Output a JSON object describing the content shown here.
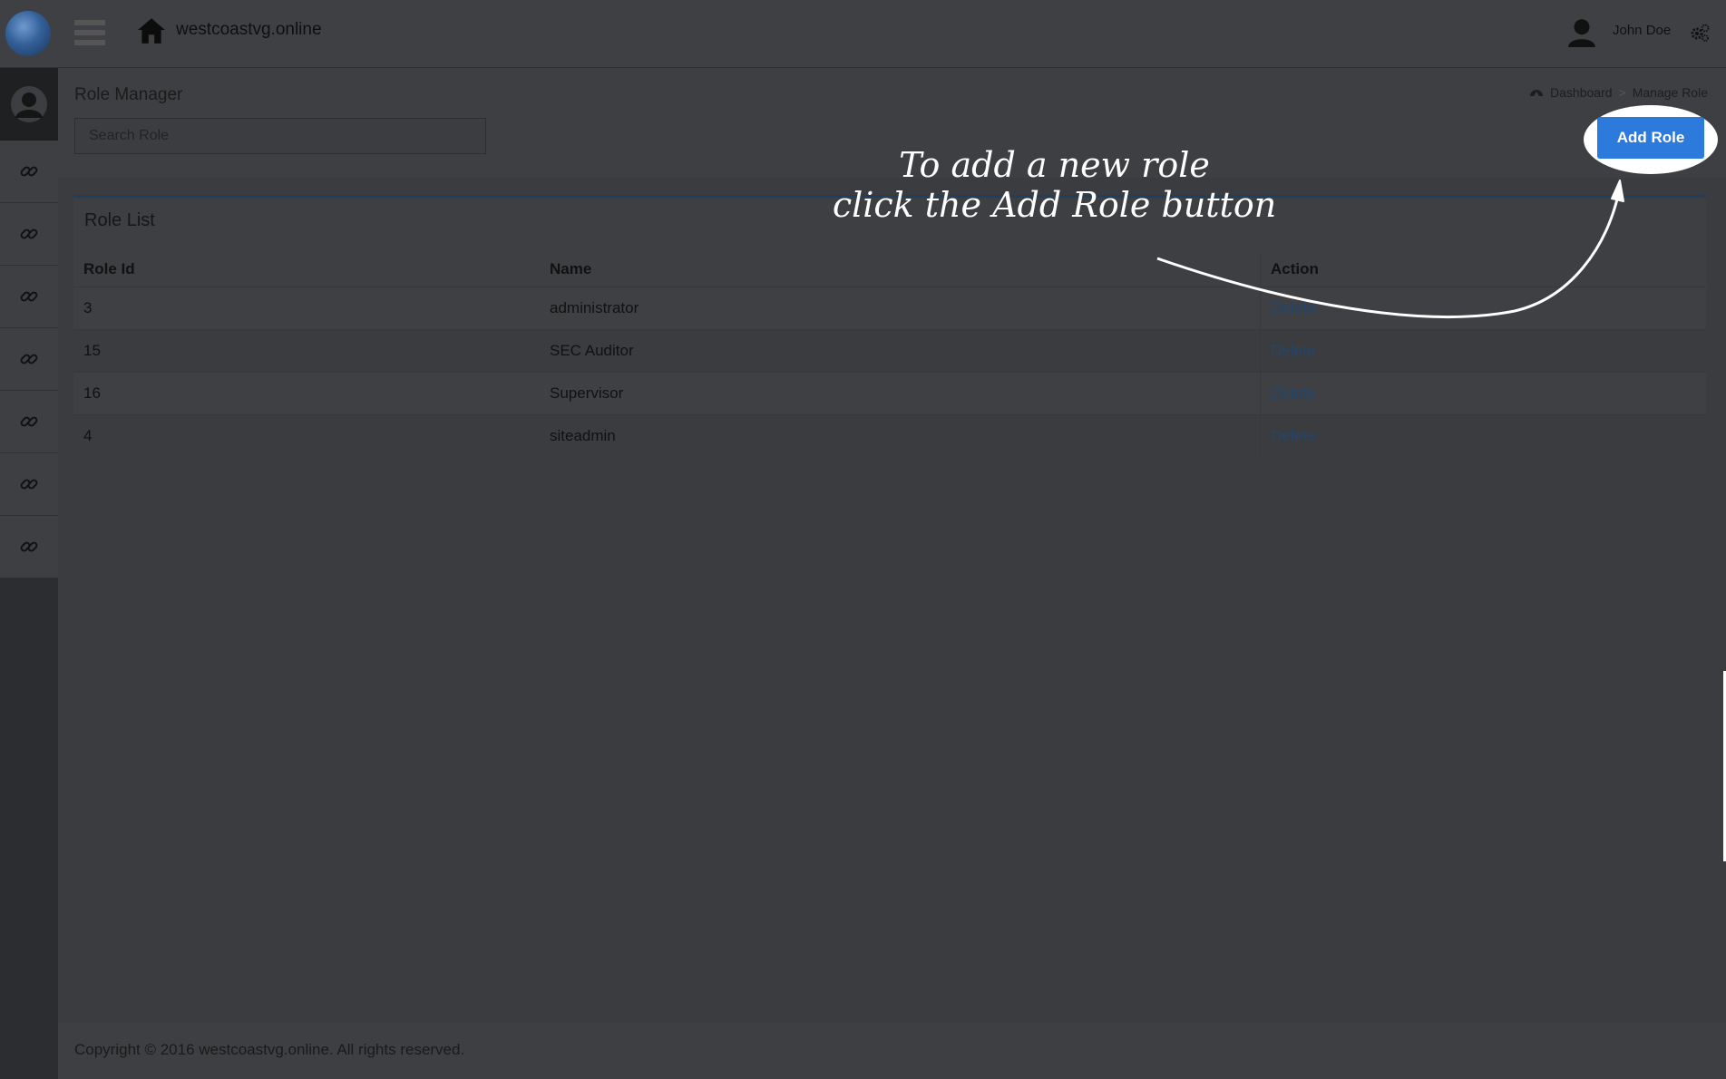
{
  "header": {
    "site_name": "westcoastvg.online",
    "user_name": "John Doe"
  },
  "sidebar": {
    "items": [
      {
        "icon": "link-icon"
      },
      {
        "icon": "link-icon"
      },
      {
        "icon": "link-icon"
      },
      {
        "icon": "link-icon"
      },
      {
        "icon": "link-icon"
      },
      {
        "icon": "link-icon"
      },
      {
        "icon": "link-icon"
      }
    ]
  },
  "page": {
    "title": "Role Manager",
    "search_placeholder": "Search Role",
    "add_role_label": "Add Role",
    "breadcrumb": [
      "Dashboard",
      "Manage Role"
    ]
  },
  "role_list": {
    "title": "Role List",
    "columns": [
      "Role Id",
      "Name",
      "Action"
    ],
    "rows": [
      {
        "id": "3",
        "name": "administrator",
        "action": "Delete"
      },
      {
        "id": "15",
        "name": "SEC Auditor",
        "action": "Delete"
      },
      {
        "id": "16",
        "name": "Supervisor",
        "action": "Delete"
      },
      {
        "id": "4",
        "name": "siteadmin",
        "action": "Delete"
      }
    ]
  },
  "annotation": {
    "line1": "To add a new role",
    "line2": "click the Add Role button"
  },
  "footer": {
    "copyright": "Copyright © 2016 westcoastvg.online. All rights reserved."
  },
  "colors": {
    "accent": "#2c7bdc",
    "link": "#22466b"
  }
}
